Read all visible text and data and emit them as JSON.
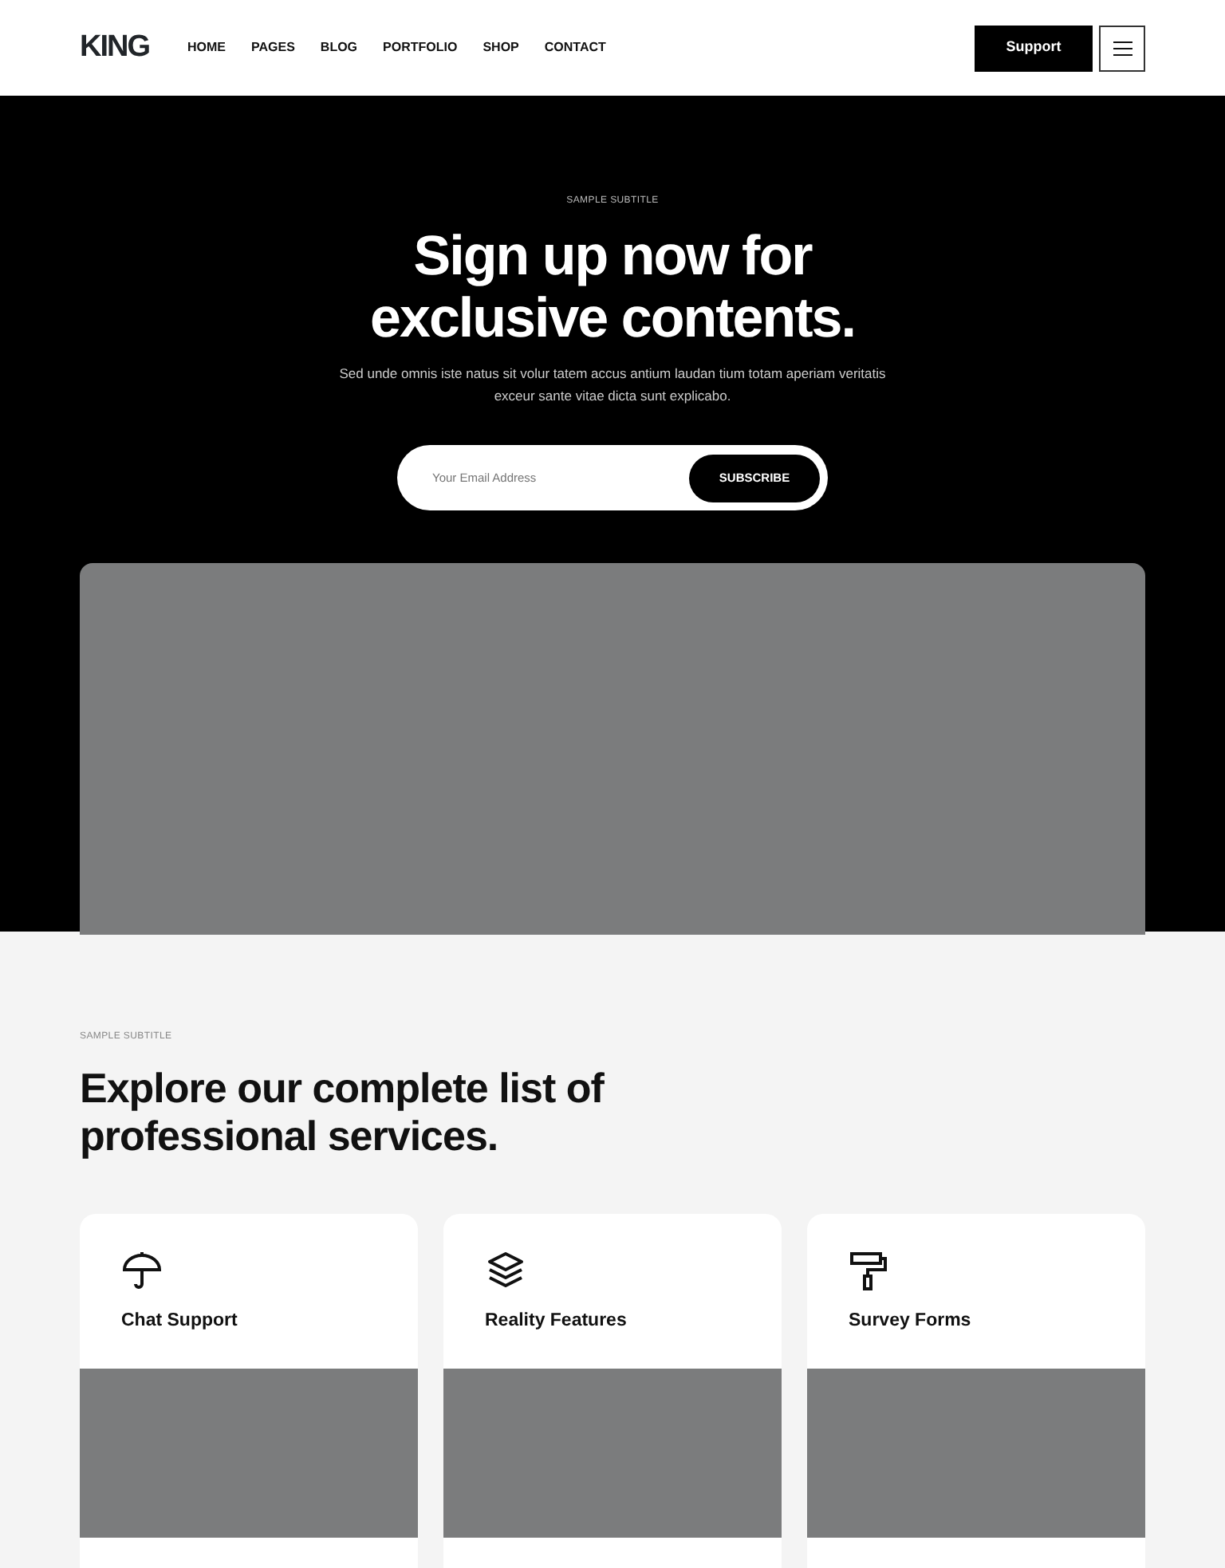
{
  "navbar": {
    "logo": "KING",
    "links": [
      "HOME",
      "PAGES",
      "BLOG",
      "PORTFOLIO",
      "SHOP",
      "CONTACT"
    ],
    "support_button": "Support"
  },
  "hero": {
    "subtitle": "SAMPLE SUBTITLE",
    "title": "Sign up now for exclusive contents.",
    "text": "Sed unde omnis iste natus sit volur tatem accus antium laudan tium totam aperiam veritatis exceur sante vitae dicta sunt explicabo.",
    "email": {
      "placeholder": "Your Email Address"
    },
    "subscribe_button": "SUBSCRIBE"
  },
  "services": {
    "subtitle": "SAMPLE SUBTITLE",
    "title": "Explore our complete list of professional services.",
    "cards": [
      {
        "title": "Chat Support"
      },
      {
        "title": "Reality Features"
      },
      {
        "title": "Survey Forms"
      }
    ]
  }
}
